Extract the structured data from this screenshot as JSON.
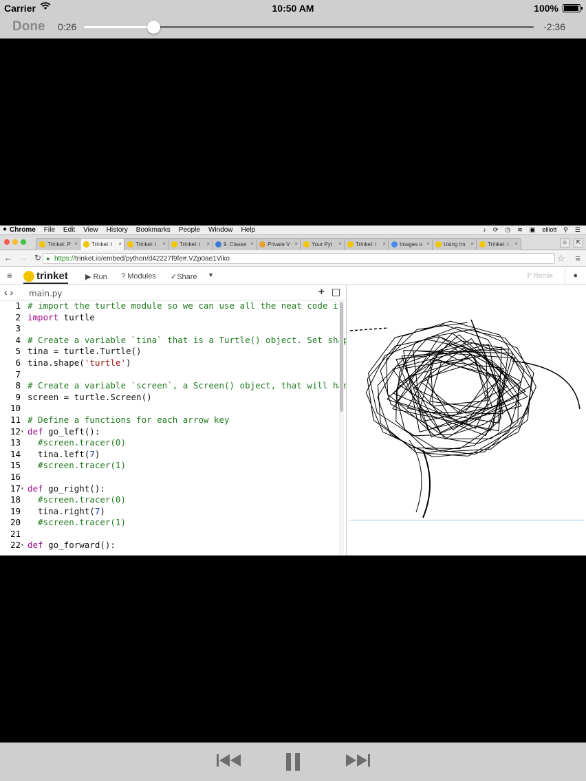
{
  "status_bar": {
    "carrier": "Carrier",
    "time": "10:50 AM",
    "battery_pct": "100%",
    "battery_level": 1.0
  },
  "player": {
    "done_label": "Done",
    "elapsed": "0:26",
    "remaining": "-2:36",
    "progress": 0.154
  },
  "mac_menu": {
    "items": [
      "Chrome",
      "File",
      "Edit",
      "View",
      "History",
      "Bookmarks",
      "People",
      "Window",
      "Help"
    ],
    "user": "elliott"
  },
  "browser": {
    "tabs": [
      {
        "label": "Trinket: P",
        "active": false
      },
      {
        "label": "Trinket: i",
        "active": true
      },
      {
        "label": "Trinket: i",
        "active": false
      },
      {
        "label": "Trinket: i",
        "active": false
      },
      {
        "label": "9. Classe",
        "active": false
      },
      {
        "label": "Private V",
        "active": false
      },
      {
        "label": "Your Pyt",
        "active": false
      },
      {
        "label": "Trinket: i",
        "active": false
      },
      {
        "label": "Images o",
        "active": false
      },
      {
        "label": "Using Im",
        "active": false
      },
      {
        "label": "Trinket: i",
        "active": false
      }
    ],
    "url_scheme": "https://",
    "url_rest": "trinket.io/embed/python/d42227f9fe#.VZp0ae1Viko"
  },
  "trinket": {
    "logo_text": "trinket",
    "run_label": "Run",
    "modules_label": "Modules",
    "share_label": "Share",
    "remix_label": "Remix",
    "file_name": "main.py"
  },
  "code_lines": [
    {
      "n": "1",
      "fold": false,
      "text": "# import the turtle module so we can use all the neat code it c",
      "kind": "comment"
    },
    {
      "n": "2",
      "fold": false,
      "text": "import turtle",
      "kind": "import"
    },
    {
      "n": "3",
      "fold": false,
      "text": "",
      "kind": "plain"
    },
    {
      "n": "4",
      "fold": false,
      "text": "# Create a variable `tina` that is a Turtle() object. Set shape",
      "kind": "comment"
    },
    {
      "n": "5",
      "fold": false,
      "text": "tina = turtle.Turtle()",
      "kind": "plain"
    },
    {
      "n": "6",
      "fold": false,
      "text": "tina.shape('turtle')",
      "kind": "string_call"
    },
    {
      "n": "7",
      "fold": false,
      "text": "",
      "kind": "plain"
    },
    {
      "n": "8",
      "fold": false,
      "text": "# Create a variable `screen`, a Screen() object, that will hand",
      "kind": "comment"
    },
    {
      "n": "9",
      "fold": false,
      "text": "screen = turtle.Screen()",
      "kind": "plain"
    },
    {
      "n": "10",
      "fold": false,
      "text": "",
      "kind": "plain"
    },
    {
      "n": "11",
      "fold": false,
      "text": "# Define a functions for each arrow key",
      "kind": "comment"
    },
    {
      "n": "12",
      "fold": true,
      "text": "def go_left():",
      "kind": "def"
    },
    {
      "n": "13",
      "fold": false,
      "text": "  #screen.tracer(0)",
      "kind": "comment"
    },
    {
      "n": "14",
      "fold": false,
      "text": "  tina.left(7)",
      "kind": "number_call"
    },
    {
      "n": "15",
      "fold": false,
      "text": "  #screen.tracer(1)",
      "kind": "comment"
    },
    {
      "n": "16",
      "fold": false,
      "text": "",
      "kind": "plain"
    },
    {
      "n": "17",
      "fold": true,
      "text": "def go_right():",
      "kind": "def"
    },
    {
      "n": "18",
      "fold": false,
      "text": "  #screen.tracer(0)",
      "kind": "comment"
    },
    {
      "n": "19",
      "fold": false,
      "text": "  tina.right(7)",
      "kind": "number_call"
    },
    {
      "n": "20",
      "fold": false,
      "text": "  #screen.tracer(1)",
      "kind": "comment"
    },
    {
      "n": "21",
      "fold": false,
      "text": "",
      "kind": "plain"
    },
    {
      "n": "22",
      "fold": true,
      "text": "def go_forward():",
      "kind": "def"
    }
  ],
  "colors": {
    "comment": "#1f7a1f",
    "keyword": "#a00a8a",
    "string": "#a01010",
    "number": "#1a3aa0",
    "trinket_yellow": "#f2c500"
  },
  "icons": {
    "wifi": "wifi-icon",
    "battery": "battery-icon",
    "rewind": "rewind-icon",
    "pause": "pause-icon",
    "fast_forward": "fast-forward-icon"
  }
}
